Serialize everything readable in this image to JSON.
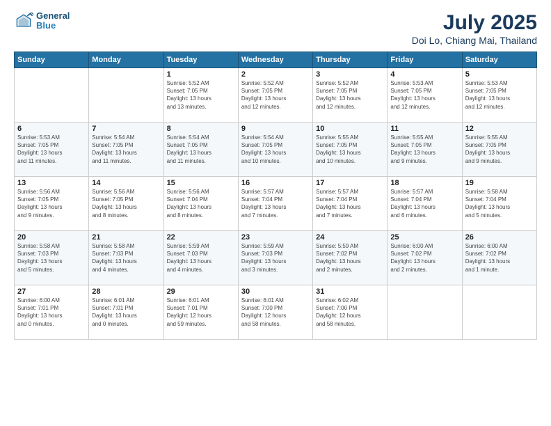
{
  "header": {
    "logo": {
      "general": "General",
      "blue": "Blue"
    },
    "title": "July 2025",
    "location": "Doi Lo, Chiang Mai, Thailand"
  },
  "weekdays": [
    "Sunday",
    "Monday",
    "Tuesday",
    "Wednesday",
    "Thursday",
    "Friday",
    "Saturday"
  ],
  "weeks": [
    [
      {
        "day": "",
        "info": ""
      },
      {
        "day": "",
        "info": ""
      },
      {
        "day": "1",
        "info": "Sunrise: 5:52 AM\nSunset: 7:05 PM\nDaylight: 13 hours\nand 13 minutes."
      },
      {
        "day": "2",
        "info": "Sunrise: 5:52 AM\nSunset: 7:05 PM\nDaylight: 13 hours\nand 12 minutes."
      },
      {
        "day": "3",
        "info": "Sunrise: 5:52 AM\nSunset: 7:05 PM\nDaylight: 13 hours\nand 12 minutes."
      },
      {
        "day": "4",
        "info": "Sunrise: 5:53 AM\nSunset: 7:05 PM\nDaylight: 13 hours\nand 12 minutes."
      },
      {
        "day": "5",
        "info": "Sunrise: 5:53 AM\nSunset: 7:05 PM\nDaylight: 13 hours\nand 12 minutes."
      }
    ],
    [
      {
        "day": "6",
        "info": "Sunrise: 5:53 AM\nSunset: 7:05 PM\nDaylight: 13 hours\nand 11 minutes."
      },
      {
        "day": "7",
        "info": "Sunrise: 5:54 AM\nSunset: 7:05 PM\nDaylight: 13 hours\nand 11 minutes."
      },
      {
        "day": "8",
        "info": "Sunrise: 5:54 AM\nSunset: 7:05 PM\nDaylight: 13 hours\nand 11 minutes."
      },
      {
        "day": "9",
        "info": "Sunrise: 5:54 AM\nSunset: 7:05 PM\nDaylight: 13 hours\nand 10 minutes."
      },
      {
        "day": "10",
        "info": "Sunrise: 5:55 AM\nSunset: 7:05 PM\nDaylight: 13 hours\nand 10 minutes."
      },
      {
        "day": "11",
        "info": "Sunrise: 5:55 AM\nSunset: 7:05 PM\nDaylight: 13 hours\nand 9 minutes."
      },
      {
        "day": "12",
        "info": "Sunrise: 5:55 AM\nSunset: 7:05 PM\nDaylight: 13 hours\nand 9 minutes."
      }
    ],
    [
      {
        "day": "13",
        "info": "Sunrise: 5:56 AM\nSunset: 7:05 PM\nDaylight: 13 hours\nand 9 minutes."
      },
      {
        "day": "14",
        "info": "Sunrise: 5:56 AM\nSunset: 7:05 PM\nDaylight: 13 hours\nand 8 minutes."
      },
      {
        "day": "15",
        "info": "Sunrise: 5:56 AM\nSunset: 7:04 PM\nDaylight: 13 hours\nand 8 minutes."
      },
      {
        "day": "16",
        "info": "Sunrise: 5:57 AM\nSunset: 7:04 PM\nDaylight: 13 hours\nand 7 minutes."
      },
      {
        "day": "17",
        "info": "Sunrise: 5:57 AM\nSunset: 7:04 PM\nDaylight: 13 hours\nand 7 minutes."
      },
      {
        "day": "18",
        "info": "Sunrise: 5:57 AM\nSunset: 7:04 PM\nDaylight: 13 hours\nand 6 minutes."
      },
      {
        "day": "19",
        "info": "Sunrise: 5:58 AM\nSunset: 7:04 PM\nDaylight: 13 hours\nand 5 minutes."
      }
    ],
    [
      {
        "day": "20",
        "info": "Sunrise: 5:58 AM\nSunset: 7:03 PM\nDaylight: 13 hours\nand 5 minutes."
      },
      {
        "day": "21",
        "info": "Sunrise: 5:58 AM\nSunset: 7:03 PM\nDaylight: 13 hours\nand 4 minutes."
      },
      {
        "day": "22",
        "info": "Sunrise: 5:59 AM\nSunset: 7:03 PM\nDaylight: 13 hours\nand 4 minutes."
      },
      {
        "day": "23",
        "info": "Sunrise: 5:59 AM\nSunset: 7:03 PM\nDaylight: 13 hours\nand 3 minutes."
      },
      {
        "day": "24",
        "info": "Sunrise: 5:59 AM\nSunset: 7:02 PM\nDaylight: 13 hours\nand 2 minutes."
      },
      {
        "day": "25",
        "info": "Sunrise: 6:00 AM\nSunset: 7:02 PM\nDaylight: 13 hours\nand 2 minutes."
      },
      {
        "day": "26",
        "info": "Sunrise: 6:00 AM\nSunset: 7:02 PM\nDaylight: 13 hours\nand 1 minute."
      }
    ],
    [
      {
        "day": "27",
        "info": "Sunrise: 6:00 AM\nSunset: 7:01 PM\nDaylight: 13 hours\nand 0 minutes."
      },
      {
        "day": "28",
        "info": "Sunrise: 6:01 AM\nSunset: 7:01 PM\nDaylight: 13 hours\nand 0 minutes."
      },
      {
        "day": "29",
        "info": "Sunrise: 6:01 AM\nSunset: 7:01 PM\nDaylight: 12 hours\nand 59 minutes."
      },
      {
        "day": "30",
        "info": "Sunrise: 6:01 AM\nSunset: 7:00 PM\nDaylight: 12 hours\nand 58 minutes."
      },
      {
        "day": "31",
        "info": "Sunrise: 6:02 AM\nSunset: 7:00 PM\nDaylight: 12 hours\nand 58 minutes."
      },
      {
        "day": "",
        "info": ""
      },
      {
        "day": "",
        "info": ""
      }
    ]
  ]
}
